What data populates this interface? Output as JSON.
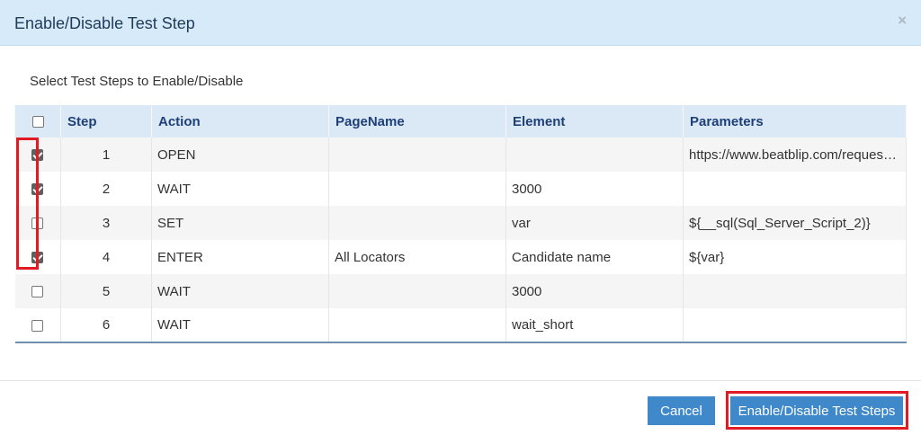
{
  "dialog": {
    "title": "Enable/Disable Test Step",
    "close_glyph": "×"
  },
  "instructions": "Select Test Steps to Enable/Disable",
  "table": {
    "columns": [
      "Step",
      "Action",
      "PageName",
      "Element",
      "Parameters"
    ],
    "header_checked": false,
    "rows": [
      {
        "checked": true,
        "step": "1",
        "action": "OPEN",
        "page": "",
        "element": "",
        "params": "https://www.beatblip.com/request-demo"
      },
      {
        "checked": true,
        "step": "2",
        "action": "WAIT",
        "page": "",
        "element": "3000",
        "params": ""
      },
      {
        "checked": false,
        "step": "3",
        "action": "SET",
        "page": "",
        "element": "var",
        "params": "${__sql(Sql_Server_Script_2)}"
      },
      {
        "checked": true,
        "step": "4",
        "action": "ENTER",
        "page": "All Locators",
        "element": "Candidate name",
        "params": "${var}"
      },
      {
        "checked": false,
        "step": "5",
        "action": "WAIT",
        "page": "",
        "element": "3000",
        "params": ""
      },
      {
        "checked": false,
        "step": "6",
        "action": "WAIT",
        "page": "",
        "element": "wait_short",
        "params": ""
      }
    ]
  },
  "footer": {
    "cancel_label": "Cancel",
    "primary_label": "Enable/Disable Test Steps"
  },
  "colors": {
    "header_bg": "#d6eaf9",
    "table_header_bg": "#dbe9f7",
    "button_bg": "#3f88c9",
    "highlight": "#e01b24"
  }
}
